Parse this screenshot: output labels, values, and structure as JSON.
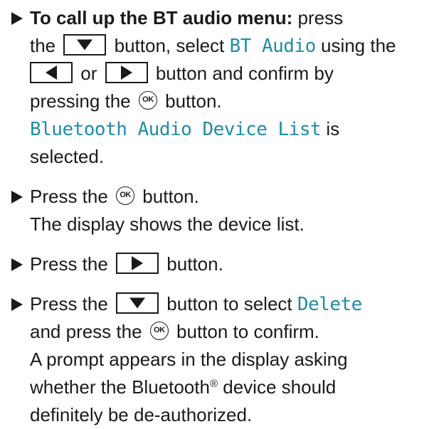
{
  "steps": [
    {
      "lead_bold": "To call up the BT audio menu:",
      "t_press": "press",
      "t_the": "the",
      "t_button_select": "button, select",
      "m_bt_audio": "BT Audio",
      "t_using_the": "using the",
      "t_or": "or",
      "t_button_confirm_by": "button and confirm by",
      "t_pressing_the": "pressing the",
      "t_button_end": "button.",
      "m_device_list": "Bluetooth Audio Device List",
      "t_is": "is",
      "t_selected": "selected."
    },
    {
      "t_press_the": "Press the",
      "t_button_end": "button.",
      "result": "The display shows the device list."
    },
    {
      "t_press_the": "Press the",
      "t_button_end": "button."
    },
    {
      "t_press_the": "Press the",
      "t_button_to_select": "button to select",
      "m_delete": "Delete",
      "t_and_press_the": "and press the",
      "t_button_to_confirm": "button to confirm.",
      "result_line1": "A prompt appears in the display asking",
      "result_line2a": "whether the Bluetooth",
      "result_reg": "®",
      "result_line2b": "device should",
      "result_line3": "definitely be de-authorized."
    }
  ],
  "keys": {
    "down": "down-triangle-icon",
    "left": "left-triangle-icon",
    "right": "right-triangle-icon",
    "ok_label": "OK"
  },
  "colors": {
    "text": "#1a1a1a",
    "display_text": "#1e8ca8"
  }
}
